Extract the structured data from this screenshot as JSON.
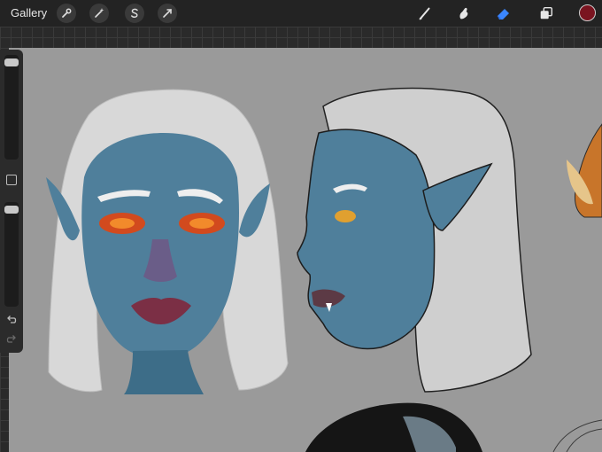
{
  "topbar": {
    "gallery_label": "Gallery",
    "action_icons": [
      "wrench-icon",
      "magic-wand-icon",
      "selection-s-icon",
      "transform-arrow-icon"
    ],
    "tool_icons": [
      "brush-icon",
      "smudge-icon",
      "eraser-icon",
      "layers-icon"
    ],
    "active_tool": "eraser-icon",
    "current_color": "#7a1420",
    "accent": "#3a86ff"
  },
  "sidebar": {
    "brush_size_level": 0.96,
    "opacity_level": 0.96,
    "icons": [
      "modify-button-icon",
      "undo-icon",
      "redo-icon"
    ]
  },
  "canvas": {
    "background": "#9a9a9a",
    "artwork": [
      "front-view-elf-portrait",
      "profile-view-elf-portrait",
      "partial-elf-portrait-right",
      "dark-hair-portrait-bottom",
      "sketch-bottom-right"
    ]
  }
}
